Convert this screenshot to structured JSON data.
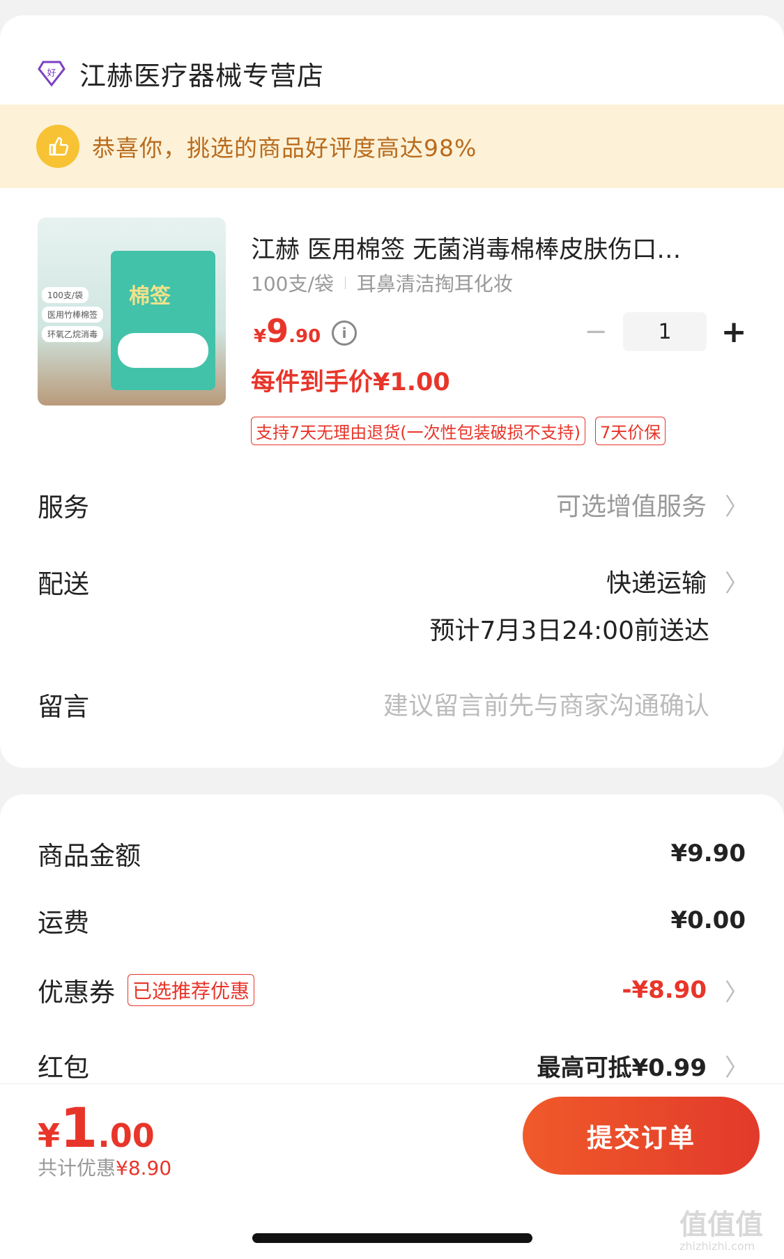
{
  "store": {
    "name": "江赫医疗器械专营店",
    "badge_icon": "good-store-diamond-icon"
  },
  "banner": {
    "text": "恭喜你，挑选的商品好评度高达98%",
    "icon": "thumbs-up-icon"
  },
  "product": {
    "image_title": "棉签",
    "image_tags": [
      "100支/袋",
      "医用竹棒棉签",
      "环氧乙烷消毒"
    ],
    "title": "江赫 医用棉签 无菌消毒棉棒皮肤伤口…",
    "spec": "100支/袋",
    "spec_extra": "耳鼻清洁掏耳化妆",
    "price": {
      "currency": "¥",
      "int": "9",
      "dec": ".90"
    },
    "hand_price": "每件到手价¥1.00",
    "tags": [
      "支持7天无理由退货(一次性包装破损不支持)",
      "7天价保"
    ]
  },
  "stepper": {
    "minus": "−",
    "qty": "1",
    "plus": "+"
  },
  "rows": {
    "service": {
      "label": "服务",
      "value": "可选增值服务"
    },
    "delivery": {
      "label": "配送",
      "value": "快递运输",
      "eta": "预计7月3日24:00前送达"
    },
    "message": {
      "label": "留言",
      "placeholder": "建议留言前先与商家沟通确认"
    }
  },
  "summary": {
    "goods": {
      "label": "商品金额",
      "amount": "¥9.90"
    },
    "shipping": {
      "label": "运费",
      "amount": "¥0.00"
    },
    "coupon": {
      "label": "优惠券",
      "tag": "已选推荐优惠",
      "amount": "-¥8.90"
    },
    "redpacket": {
      "label": "红包",
      "amount": "最高可抵¥0.99"
    }
  },
  "footer": {
    "total": {
      "currency": "¥",
      "int": "1",
      "dec": ".00"
    },
    "saved_label": "共计优惠",
    "saved_amount": "¥8.90",
    "submit": "提交订单"
  },
  "watermark": {
    "main": "值值值",
    "sub": "zhizhizhi.com"
  },
  "colors": {
    "accent": "#e8352a",
    "banner_bg": "#fdf2d8",
    "banner_text": "#b86b1d"
  }
}
